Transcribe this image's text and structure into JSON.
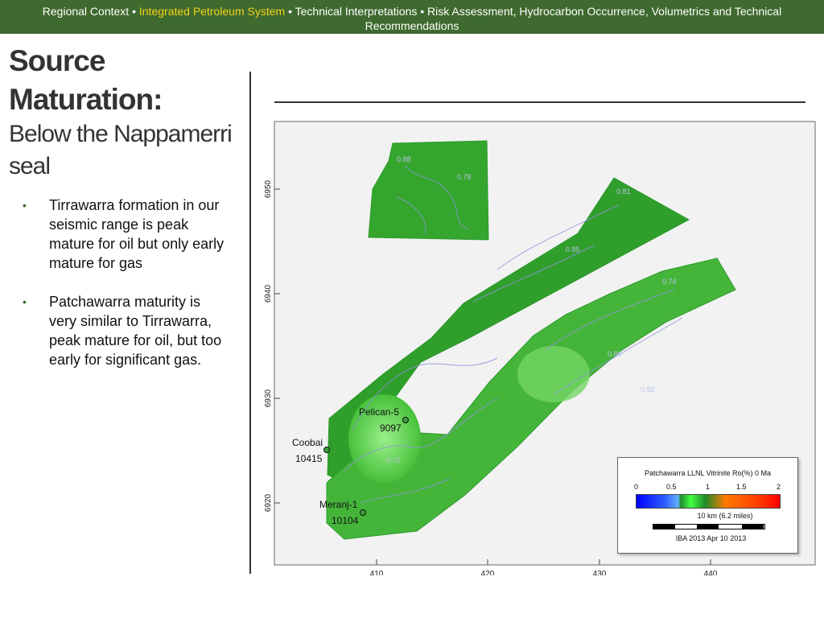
{
  "colors": {
    "brand_green": "#3f6a2f",
    "brand_yellow": "#f2d21b"
  },
  "header": {
    "part1": "Regional Context •",
    "highlight": "Integrated Petroleum System",
    "part2": "• Technical Interpretations • Risk Assessment,  Hydrocarbon Occurrence, Volumetrics and Technical Recommendations"
  },
  "slide": {
    "title_bold": "Source Maturation:",
    "title_sub": "Below the Nappamerri seal",
    "bullets": [
      "Tirrawarra formation in our seismic range  is peak mature for oil but only early mature for gas",
      "Patchawarra maturity is very similar to Tirrawarra, peak mature for oil, but too early for significant gas."
    ],
    "bullet_symbol": "•"
  },
  "map": {
    "y_ticks": [
      "6950",
      "6940",
      "6930",
      "6920"
    ],
    "x_ticks": [
      "410",
      "420",
      "430",
      "440"
    ],
    "contour_labels": [
      "0.88",
      "0.78",
      "0.81",
      "0.85",
      "0.74",
      "0.86",
      "0.92",
      "0.72"
    ],
    "wells": [
      {
        "name": "Pelican-5",
        "value": "9097"
      },
      {
        "name": "Coobai",
        "value": "10415"
      },
      {
        "name": "Meranj-1",
        "value": "10104"
      }
    ]
  },
  "legend": {
    "title": "Patchawarra LLNL Vitrinite Ro(%) 0 Ma",
    "ticks": [
      "0",
      "0.5",
      "1",
      "1.5",
      "2"
    ],
    "scale_label": "10 km  (6.2 miles)",
    "stamp": "IBA 2013 Apr 10 2013"
  }
}
